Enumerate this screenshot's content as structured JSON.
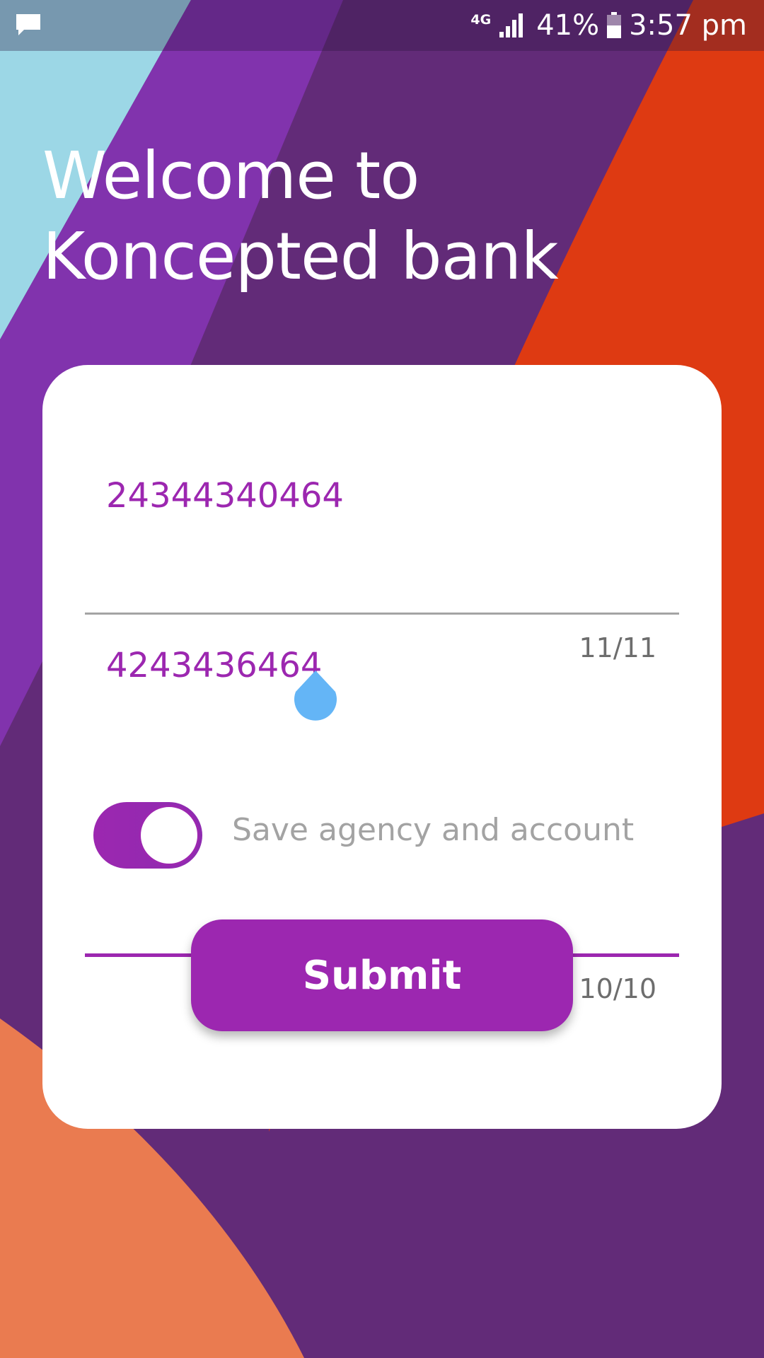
{
  "status_bar": {
    "network_type": "4G",
    "battery_percent": "41%",
    "time": "3:57 pm",
    "icons": [
      "message-icon",
      "signal-icon",
      "battery-icon"
    ]
  },
  "header": {
    "title_line1": "Welcome to",
    "title_line2": "Koncepted bank"
  },
  "form": {
    "account_field": {
      "value": "24344340464",
      "counter": "11/11"
    },
    "agency_field": {
      "value": "4243436464",
      "counter": "10/10"
    },
    "save_toggle": {
      "label": "Save agency and account",
      "checked": true
    },
    "submit_label": "Submit"
  },
  "colors": {
    "accent": "#9c27b0",
    "cursor_handle": "#64b5f6",
    "background_purple": "#622b78",
    "background_violet": "#8133ad",
    "background_orange": "#de3a12",
    "background_peach": "#ea7b50",
    "background_sky": "#9cd7e6"
  }
}
